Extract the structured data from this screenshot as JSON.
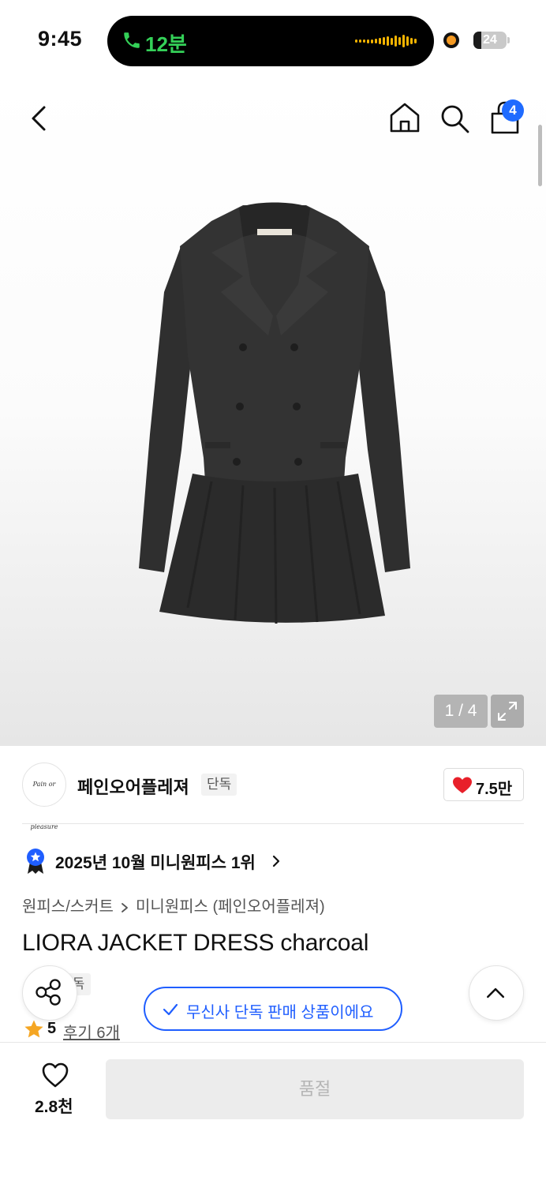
{
  "status_bar": {
    "time": "9:45",
    "call_duration": "12분",
    "battery_level": "24",
    "battery_fraction": 0.24
  },
  "nav": {
    "cart_count": "4",
    "icons": [
      "back-chevron-icon",
      "home-icon",
      "search-icon",
      "shopping-bag-icon"
    ]
  },
  "gallery": {
    "pager": "1 / 4",
    "current_page": 1,
    "total_pages": 4
  },
  "brand": {
    "name": "페인오어플레져",
    "tag": "단독",
    "logo_text": "Pain or pleasure",
    "likes": "7.5만"
  },
  "ranking": {
    "text": "2025년 10월 미니원피스 1위"
  },
  "breadcrumb": {
    "level1": "원피스/스커트",
    "level2": "미니원피스 (페인오어플레져)"
  },
  "product": {
    "title": "LIORA JACKET DRESS charcoal",
    "exclusive_tag": "단독",
    "rating": "5",
    "review_link": "후기 6개"
  },
  "toast": {
    "text": "무신사 단독 판매 상품이에요"
  },
  "bottom_bar": {
    "wish_count": "2.8천",
    "buy_button": "품절"
  },
  "colors": {
    "accent_blue": "#1f5eff",
    "heart_red": "#e8202a",
    "star_orange": "#f5a623",
    "call_green": "#34d058"
  }
}
